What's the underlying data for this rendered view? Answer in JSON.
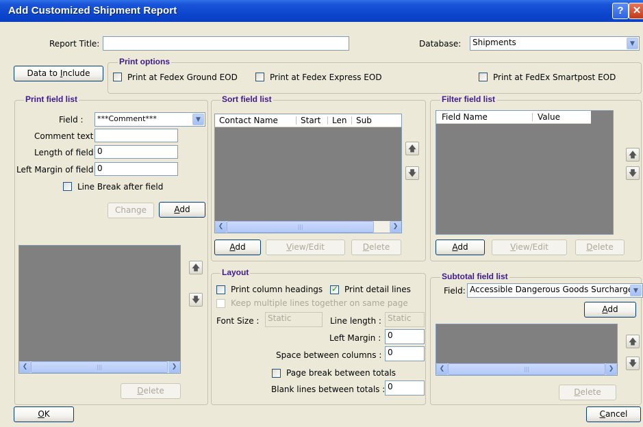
{
  "window": {
    "title": "Add Customized Shipment Report",
    "help_btn": "?",
    "close_btn": "✕"
  },
  "header": {
    "report_title_label": "Report Title:",
    "report_title_value": "",
    "database_label": "Database:",
    "database_value": "Shipments",
    "data_to_include": {
      "pre": "Data to ",
      "key": "I",
      "post": "nclude"
    }
  },
  "print_options": {
    "title": "Print options",
    "ground": "Print at Fedex Ground EOD",
    "express": "Print at Fedex Express EOD",
    "smartpost": "Print at FedEx Smartpost EOD"
  },
  "print_field_list": {
    "title": "Print field list",
    "field_label": "Field :",
    "field_value": "***Comment***",
    "comment_label": "Comment text :",
    "comment_value": "",
    "length_label": "Length of field:",
    "length_value": "0",
    "margin_label": "Left Margin of field:",
    "margin_value": "0",
    "line_break_label": "Line Break after field",
    "change_label": "Change",
    "add": {
      "key": "A",
      "post": "dd"
    },
    "delete": {
      "key": "D",
      "post": "elete"
    }
  },
  "sort_field_list": {
    "title": "Sort field list",
    "columns": [
      "Contact Name",
      "Start",
      "Len",
      "Sub"
    ],
    "add": {
      "key": "A",
      "post": "dd"
    },
    "view": {
      "pre": "",
      "key": "V",
      "post": "iew/Edit"
    },
    "delete": {
      "key": "D",
      "post": "elete"
    }
  },
  "filter_field_list": {
    "title": "Filter field list",
    "columns": [
      "Field Name",
      "Value"
    ],
    "add": {
      "key": "A",
      "post": "dd"
    },
    "view": {
      "key": "V",
      "post": "iew/Edit"
    },
    "delete": {
      "key": "D",
      "post": "elete"
    }
  },
  "layout": {
    "title": "Layout",
    "print_column_headings": "Print column headings",
    "print_detail_lines": "Print detail lines",
    "keep_lines": "Keep multiple lines together on same page",
    "font_size_label": "Font Size :",
    "font_size_value": "Static",
    "line_length_label": "Line length :",
    "line_length_value": "Static",
    "left_margin_label": "Left Margin :",
    "left_margin_value": "0",
    "space_label": "Space between columns :",
    "space_value": "0",
    "page_break_label": "Page break between totals",
    "blank_lines_label": "Blank lines between totals :",
    "blank_lines_value": "0"
  },
  "subtotal_field_list": {
    "title": "Subtotal field list",
    "field_label": "Field:",
    "field_value": "Accessible Dangerous Goods Surcharge",
    "add": {
      "key": "A",
      "post": "dd"
    },
    "delete": {
      "key": "D",
      "post": "elete"
    }
  },
  "footer": {
    "ok": {
      "key": "O",
      "post": "K"
    },
    "cancel": {
      "key": "C",
      "post": "ancel"
    }
  },
  "scroll": {
    "left": "❮",
    "right": "❯",
    "thumb": "|||"
  },
  "arrows": {
    "up": "🡅",
    "down": "🡇",
    "dropdown": "▼"
  },
  "colors": {
    "titlebar": "#0a3fc0",
    "group_title": "#3d1a8f",
    "dialog_bg": "#ece9d8",
    "list_bg": "#808080"
  }
}
